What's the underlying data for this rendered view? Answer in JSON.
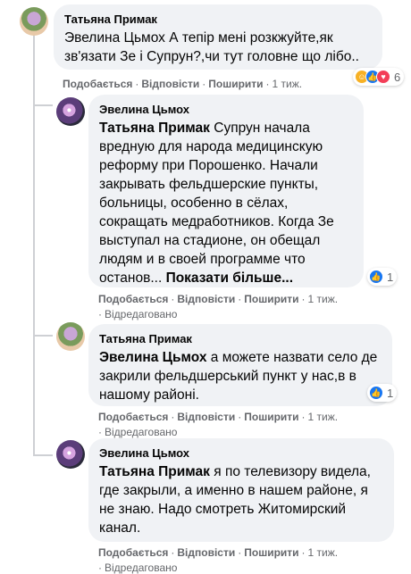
{
  "comments": [
    {
      "author": "Татьяна Примак",
      "mention": "",
      "text": "Эвелина Цьмох А тепір мені розкжуйте,як зв'язати Зе і Супрун?,чи тут головне що лібо..",
      "like": "Подобається",
      "reply": "Відповісти",
      "share": "Поширити",
      "time": "1 тиж.",
      "edited": "",
      "reaction_count": "6",
      "reaction_icons": [
        "haha-icon",
        "like-icon",
        "love-icon"
      ]
    },
    {
      "author": "Эвелина Цьмох",
      "mention": "Татьяна Примак",
      "text": "Супрун начала вредную для народа медицинскую реформу при Порошенко. Начали закрывать фельдшерские пункты, больницы, особенно в сёлах, сокращать медработников. Когда Зе выступал на стадионе, он обещал людям и в своей программе что останов...",
      "more": "Показати більше...",
      "like": "Подобається",
      "reply": "Відповісти",
      "share": "Поширити",
      "time": "1 тиж.",
      "edited": "Відредаговано",
      "reaction_count": "1",
      "reaction_icons": [
        "like-icon"
      ]
    },
    {
      "author": "Татьяна Примак",
      "mention": "Эвелина Цьмох",
      "text": "а можете назвати село де закрили фельдшерський пункт у нас,в в нашому районі.",
      "like": "Подобається",
      "reply": "Відповісти",
      "share": "Поширити",
      "time": "1 тиж.",
      "edited": "Відредаговано",
      "reaction_count": "1",
      "reaction_icons": [
        "like-icon"
      ]
    },
    {
      "author": "Эвелина Цьмох",
      "mention": "Татьяна Примак",
      "text": "я по телевизору видела, где закрыли, а именно в нашем районе, я не знаю. Надо смотреть Житомирский канал.",
      "like": "Подобається",
      "reply": "Відповісти",
      "share": "Поширити",
      "time": "1 тиж.",
      "edited": "Відредаговано",
      "reaction_count": "",
      "reaction_icons": []
    }
  ],
  "colors": {
    "bubble": "#f0f2f5",
    "meta": "#65676b",
    "like_blue": "#1877f2",
    "thread_line": "#ced0d4"
  }
}
